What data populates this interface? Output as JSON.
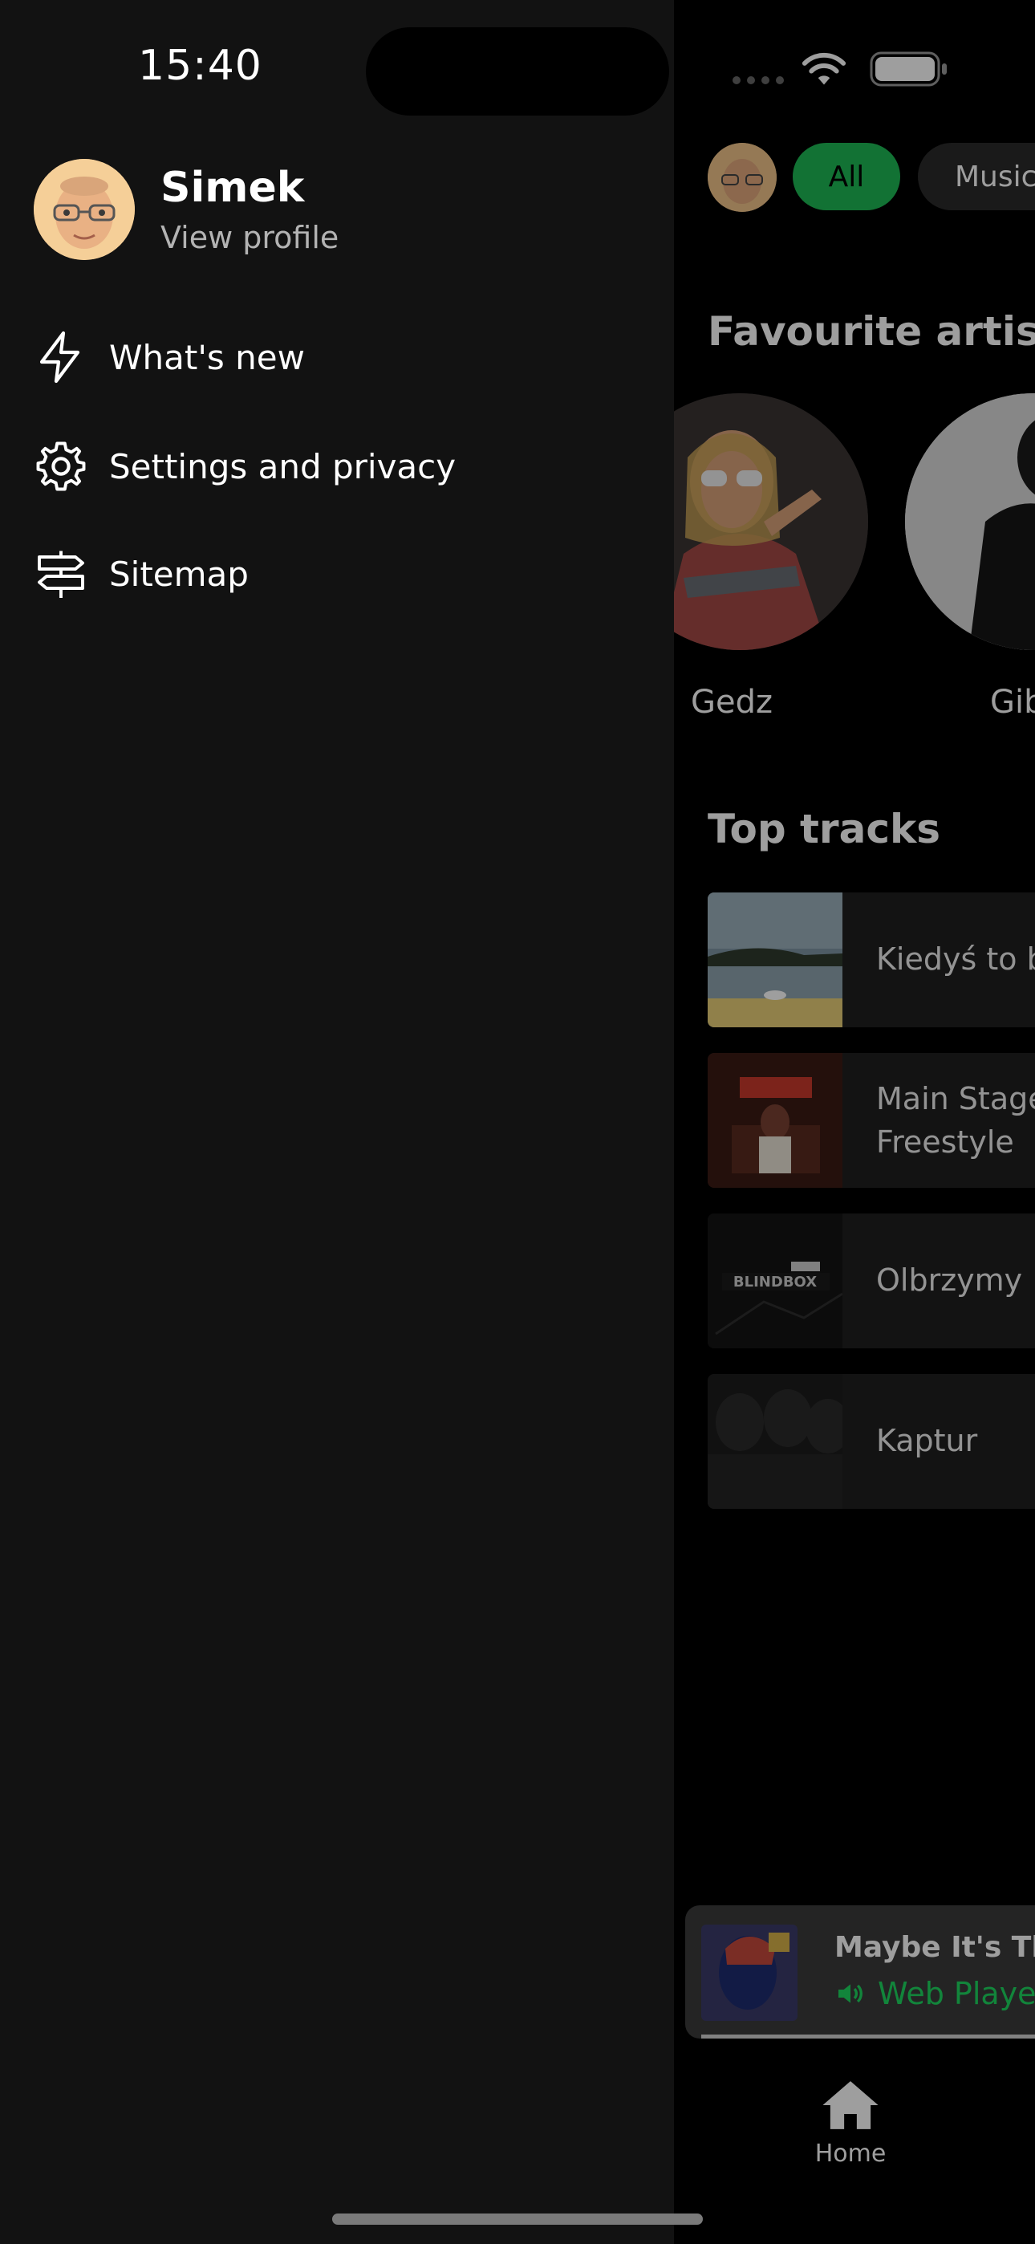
{
  "status": {
    "time": "15:40"
  },
  "profile": {
    "name": "Simek",
    "subtitle": "View profile"
  },
  "menu": [
    {
      "label": "What's new",
      "icon": "lightning-icon"
    },
    {
      "label": "Settings and privacy",
      "icon": "gear-icon"
    },
    {
      "label": "Sitemap",
      "icon": "signpost-icon"
    }
  ],
  "filters": {
    "all": "All",
    "music": "Music"
  },
  "sections": {
    "artists": "Favourite artists",
    "tracks": "Top tracks"
  },
  "artists": [
    "Gedz",
    "Gibbs"
  ],
  "tracks": [
    "Kiedyś to było",
    "Main Stage Freestyle",
    "Olbrzymy",
    "Kaptur"
  ],
  "player": {
    "title": "Maybe It's The",
    "device": "Web Player"
  },
  "tabbar": {
    "home": "Home"
  },
  "colors": {
    "accent": "#1ed760",
    "chip_active": "#1db954"
  }
}
